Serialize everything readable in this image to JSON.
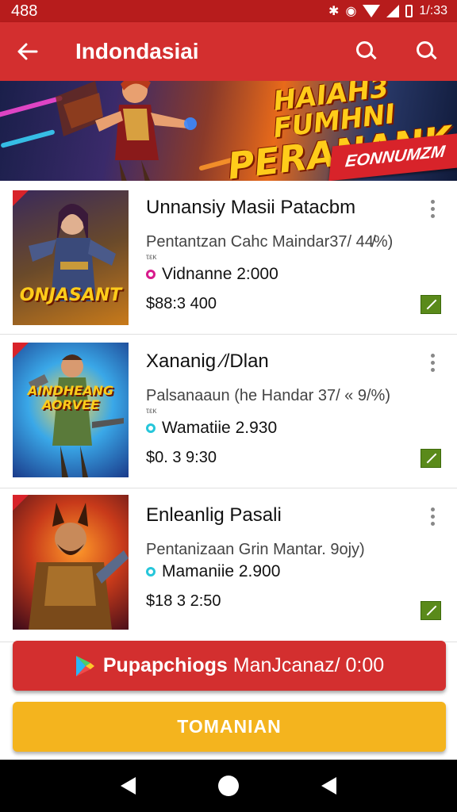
{
  "status_bar": {
    "left": "488",
    "time": "1/:33"
  },
  "app_bar": {
    "title": "Indondasiai"
  },
  "banner": {
    "line1": "HAIAH3 FUMHNI",
    "line2": "PERANANK",
    "ribbon": "EONNUMZM"
  },
  "games": [
    {
      "name": "Unnansiy Masii Patacbm",
      "desc": "Pentantzan Cahc Maindar37/ 44̸%)",
      "tag": "τεκ",
      "players": "Vidnanne 2:000",
      "price": "$88:3 400",
      "dot_color": "#d81b8c",
      "art_text": "ONJASANT"
    },
    {
      "name": "Xananig ⁄/Dlan",
      "desc": "Palsanaaun (he Handar 37/ « 9/%)",
      "tag": "τεκ",
      "players": "Wamatiie 2.930",
      "price": "$0. 3 9:30",
      "dot_color": "#26c6da",
      "art_text": "AINDHEANG AORVEE"
    },
    {
      "name": "Enleanlig Pasali",
      "desc": "Pentanizaan Grin Mantar. 9ojy)",
      "tag": "",
      "players": "Mamaniie 2.900",
      "price": "$18 3 2:50",
      "dot_color": "#26c6da",
      "art_text": ""
    }
  ],
  "buy_button": {
    "bold": "Pupapchiogs",
    "rest": "ManJcanaz/ 0:00"
  },
  "tournament_button": {
    "label": "TOMANIAN"
  },
  "colors": {
    "primary": "#d32f2f",
    "accent": "#f4b41e",
    "check": "#5a8a1a"
  }
}
